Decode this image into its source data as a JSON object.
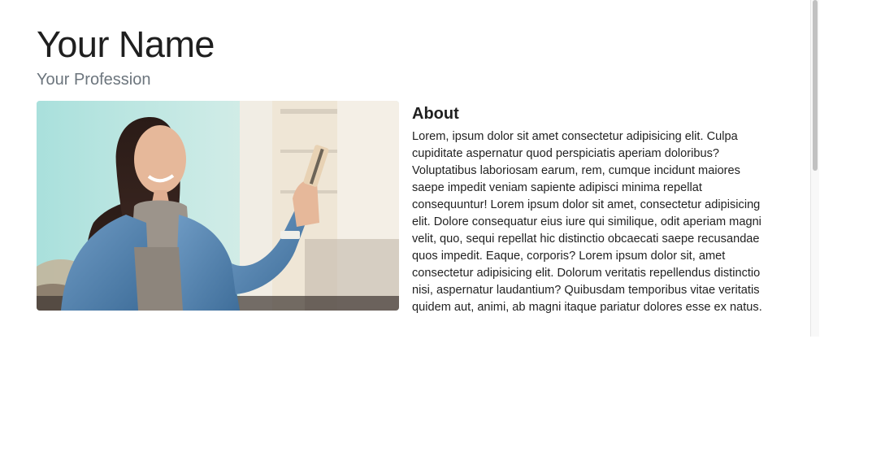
{
  "header": {
    "name": "Your Name",
    "profession": "Your Profession"
  },
  "about": {
    "heading": "About",
    "body": "Lorem, ipsum dolor sit amet consectetur adipisicing elit. Culpa cupiditate aspernatur quod perspiciatis aperiam doloribus? Voluptatibus laboriosam earum, rem, cumque incidunt maiores saepe impedit veniam sapiente adipisci minima repellat consequuntur! Lorem ipsum dolor sit amet, consectetur adipisicing elit. Dolore consequatur eius iure qui similique, odit aperiam magni velit, quo, sequi repellat hic distinctio obcaecati saepe recusandae quos impedit. Eaque, corporis? Lorem ipsum dolor sit, amet consectetur adipisicing elit. Dolorum veritatis repellendus distinctio nisi, aspernatur laudantium? Quibusdam temporibus vitae veritatis quidem aut, animi, ab magni itaque pariatur dolores esse ex natus."
  },
  "photo": {
    "subject": "woman-holding-card-photo"
  },
  "colors": {
    "text": "#1f1f1f",
    "muted": "#6c757d",
    "scrollbar_thumb": "#c1c1c1"
  }
}
